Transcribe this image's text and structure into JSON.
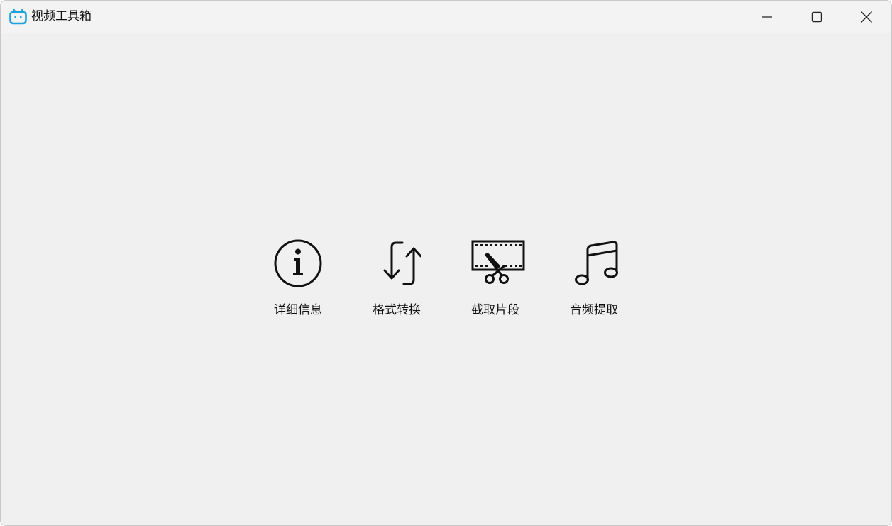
{
  "window": {
    "title": "视频工具箱",
    "app_icon": "bilibili-tv-icon",
    "accent_color": "#1ba1db"
  },
  "caption_buttons": {
    "minimize": "minimize-icon",
    "maximize": "maximize-icon",
    "close": "close-icon"
  },
  "tools": [
    {
      "label": "详细信息",
      "icon": "info-icon"
    },
    {
      "label": "格式转换",
      "icon": "convert-arrows-icon"
    },
    {
      "label": "截取片段",
      "icon": "film-scissors-icon"
    },
    {
      "label": "音频提取",
      "icon": "music-note-icon"
    }
  ]
}
